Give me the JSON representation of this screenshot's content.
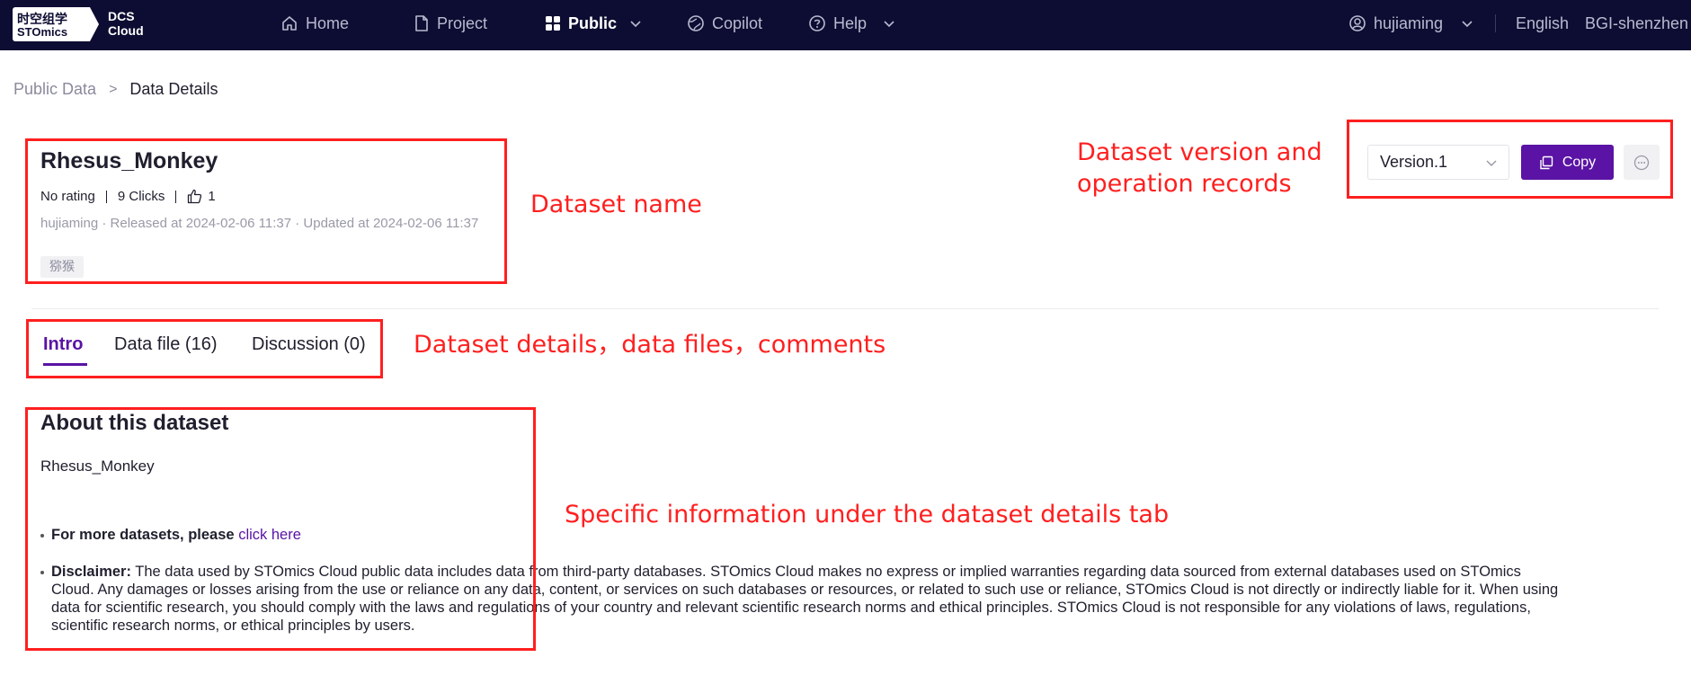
{
  "logo": {
    "cn_text": "时空组学",
    "en_text": "STOmics",
    "product_line1": "DCS",
    "product_line2": "Cloud"
  },
  "nav": {
    "items": [
      {
        "label": "Home",
        "icon": "home-icon",
        "active": false
      },
      {
        "label": "Project",
        "icon": "document-icon",
        "active": false
      },
      {
        "label": "Public",
        "icon": "grid-icon",
        "active": true,
        "dropdown": true
      },
      {
        "label": "Copilot",
        "icon": "globe-icon",
        "active": false
      },
      {
        "label": "Help",
        "icon": "help-icon",
        "active": false,
        "dropdown": true
      }
    ],
    "user": "hujiaming",
    "language": "English",
    "region": "BGI-shenzhen"
  },
  "breadcrumb": {
    "parent": "Public Data",
    "separator": ">",
    "current": "Data Details"
  },
  "dataset": {
    "name": "Rhesus_Monkey",
    "rating": "No rating",
    "clicks": "9 Clicks",
    "likes": "1",
    "meta": "hujiaming · Released at 2024-02-06 11:37 · Updated at 2024-02-06 11:37",
    "tag": "猕猴"
  },
  "actions": {
    "version": "Version.1",
    "copy_label": "Copy",
    "more_icon": "ellipsis-icon"
  },
  "tabs": [
    {
      "label": "Intro",
      "active": true
    },
    {
      "label": "Data file (16)",
      "active": false
    },
    {
      "label": "Discussion (0)",
      "active": false
    }
  ],
  "about": {
    "title": "About this dataset",
    "description": "Rhesus_Monkey",
    "more_prefix": "For more datasets, please",
    "more_link": "click here",
    "disclaimer_label": "Disclaimer:",
    "disclaimer_line1": "The data used by STOmics Cloud public data includes data from third-party databases. STOmics Cloud makes no express or implied warranties regarding data sourced from external databases used on STOmics",
    "disclaimer_line2": "Cloud. Any damages or losses arising from the use or reliance on any data, content, or services on such databases or resources, or related to such use or reliance, STOmics Cloud is not directly or indirectly liable for it. When using",
    "disclaimer_line3": "data for scientific research, you should comply with the laws and regulations of your country and relevant scientific research norms and ethical principles. STOmics Cloud is not responsible for any violations of laws, regulations,",
    "disclaimer_line4": "scientific research norms, or ethical principles by users."
  },
  "annotations": {
    "dataset_name": "Dataset name",
    "version_line1": "Dataset version and",
    "version_line2": "operation records",
    "tabs": "Dataset details，data files，comments",
    "details": "Specific information under the dataset details tab",
    "color": "#ff1f1f"
  },
  "colors": {
    "nav_bg": "#0d0d33",
    "accent": "#5a13a4"
  }
}
